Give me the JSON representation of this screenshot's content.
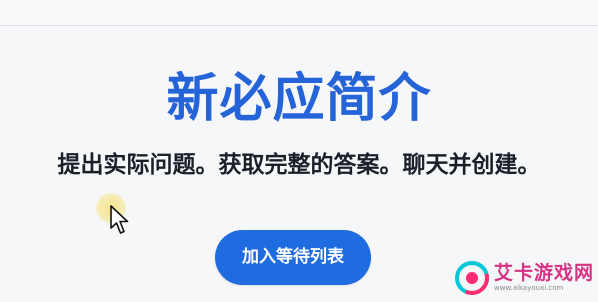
{
  "headline": "新必应简介",
  "subheadline": "提出实际问题。获取完整的答案。聊天并创建。",
  "cta": {
    "label": "加入等待列表"
  },
  "watermark": {
    "text": "艾卡游戏网",
    "subtext": "www.aikayouxi.com"
  },
  "colors": {
    "headline": "#2563d9",
    "cta_background": "#1f6be0",
    "page_background": "#f6f7f9",
    "watermark_text": "#d63384"
  },
  "icons": [
    "mouse-pointer-icon",
    "watermark-logo-icon"
  ]
}
